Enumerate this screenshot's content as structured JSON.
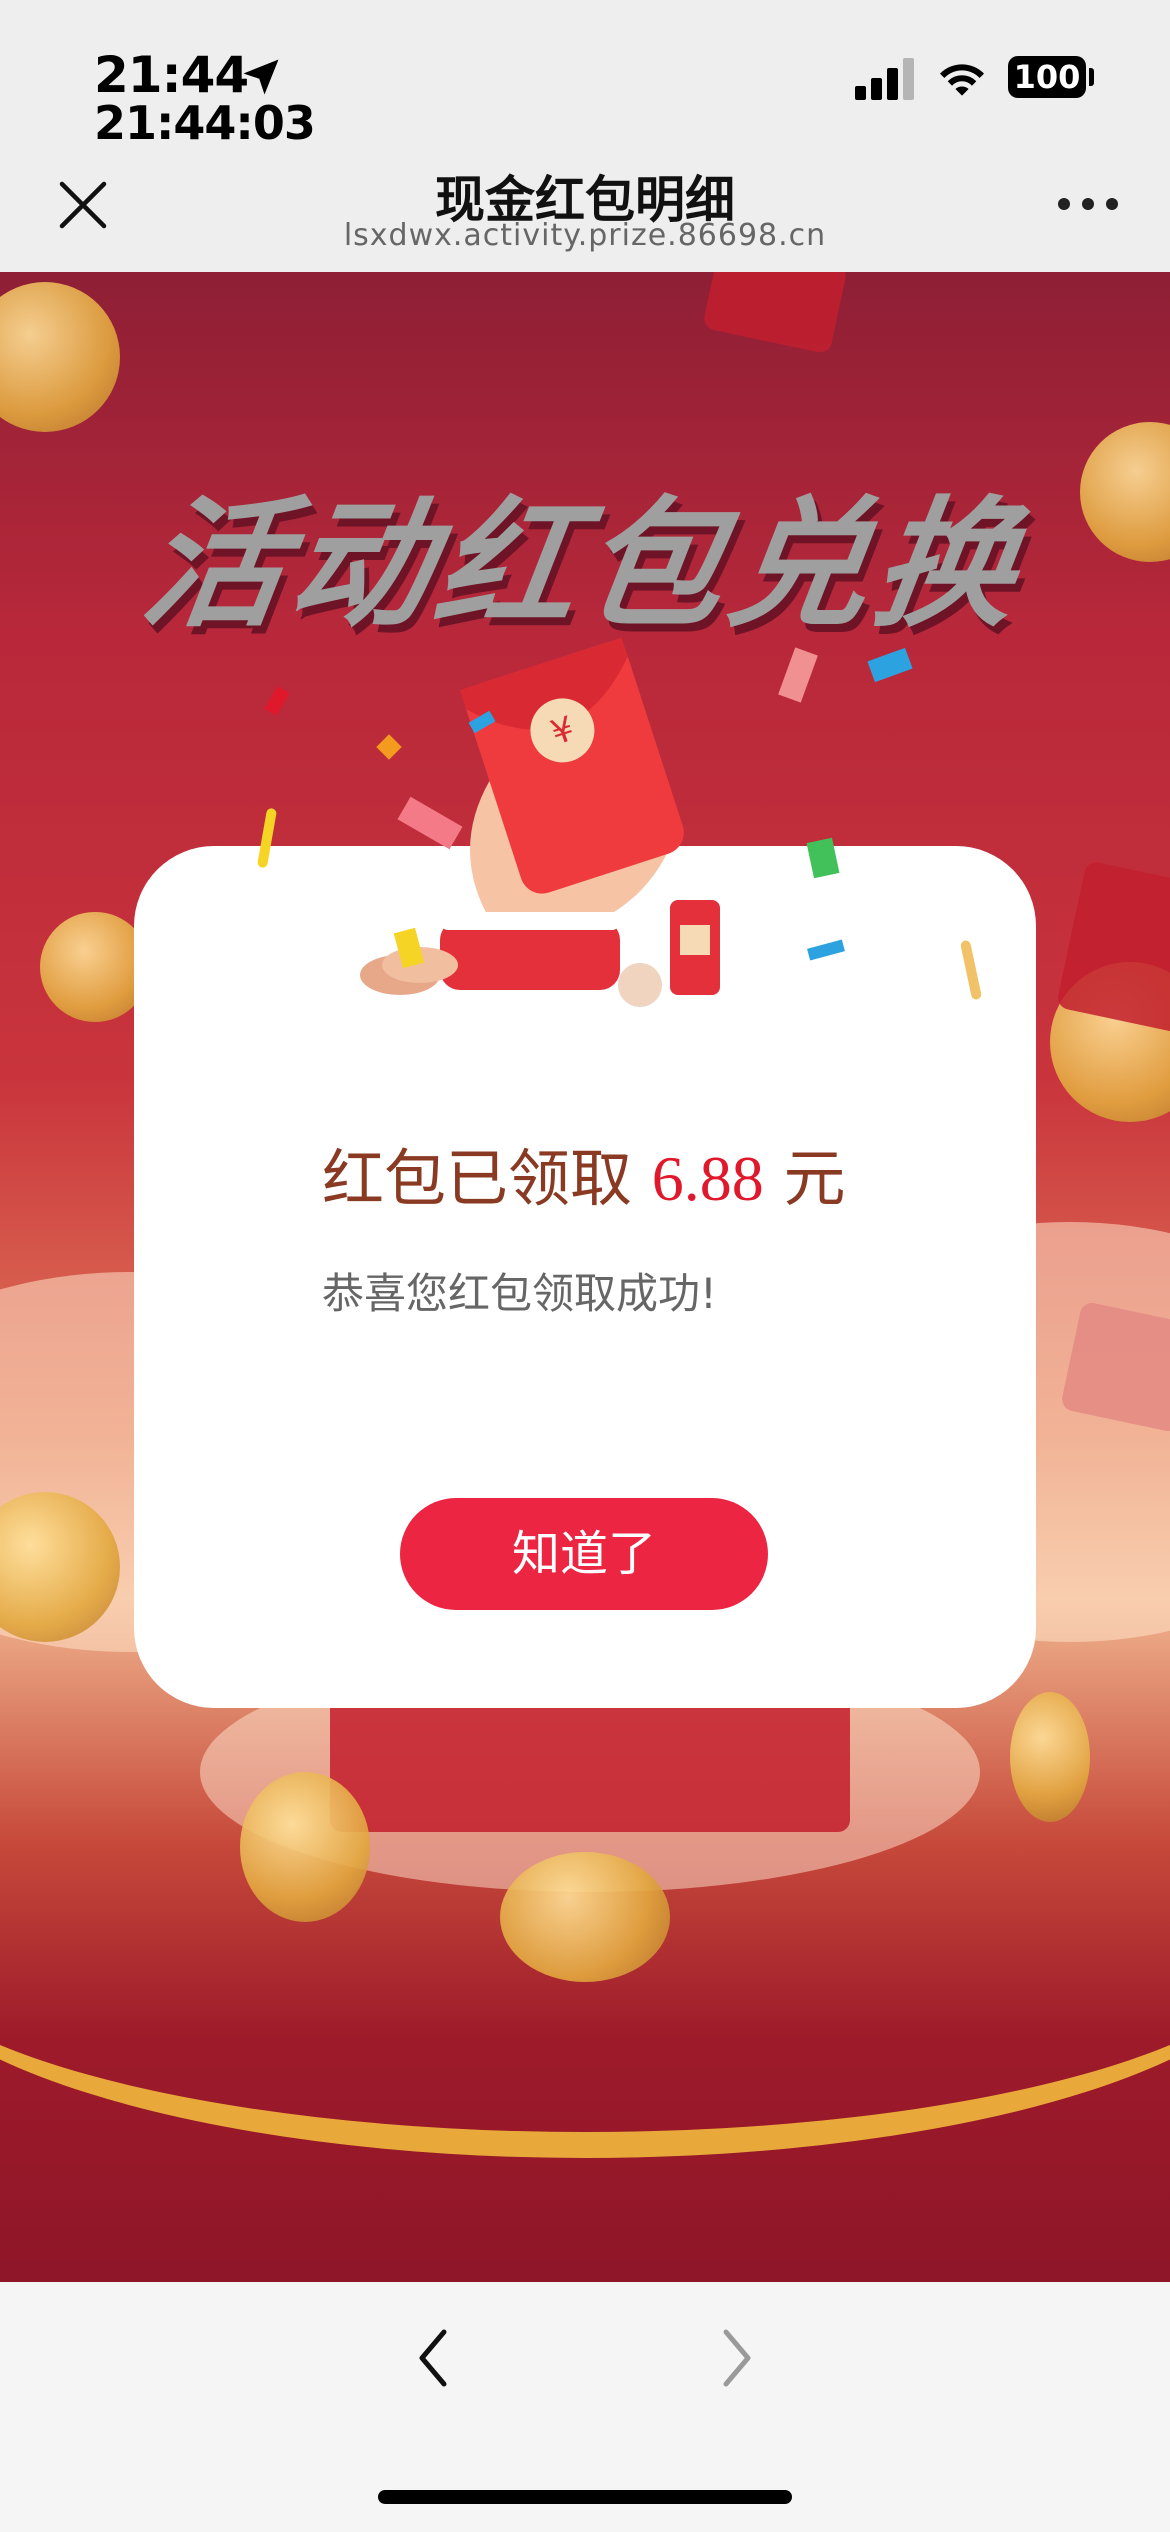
{
  "status_bar": {
    "time": "21:44",
    "time_detail": "21:44:03",
    "battery": "100",
    "icons": [
      "location-arrow-icon",
      "cellular-signal-icon",
      "wifi-icon",
      "battery-icon"
    ]
  },
  "nav": {
    "title": "现金红包明细",
    "subtitle": "lsxdwx.activity.prize.86698.cn",
    "icons": [
      "close-icon",
      "more-icon"
    ]
  },
  "page": {
    "banner": "活动红包兑换",
    "colors": {
      "background": "#b8283a",
      "banner_shadow": "#6e1426",
      "gold": "#e9a83a"
    }
  },
  "modal": {
    "title_prefix": "红包已领取",
    "amount": "6.88",
    "unit": "元",
    "message": "恭喜您红包领取成功!",
    "button": "知道了",
    "colors": {
      "title": "#8a3a22",
      "amount": "#e0182c",
      "button": "#ec2543"
    }
  },
  "toolbar": {
    "icons": [
      "chevron-left-icon",
      "chevron-right-icon"
    ]
  }
}
